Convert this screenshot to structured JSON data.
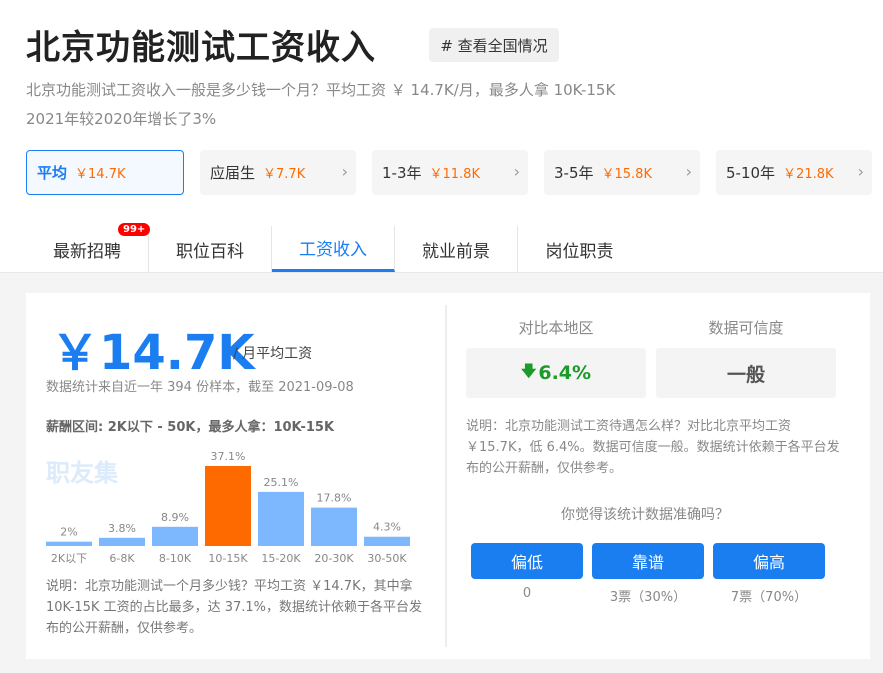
{
  "header": {
    "title": "北京功能测试工资收入",
    "national_button": "# 查看全国情况",
    "subtitle_line1": "北京功能测试工资收入一般是多少钱一个月？平均工资 ￥ 14.7K/月，最多人拿 10K-15K",
    "subtitle_line2": "2021年较2020年增长了3%"
  },
  "exp_tabs": [
    {
      "label": "平均",
      "value": "￥14.7K",
      "active": true
    },
    {
      "label": "应届生",
      "value": "￥7.7K",
      "active": false
    },
    {
      "label": "1-3年",
      "value": "￥11.8K",
      "active": false
    },
    {
      "label": "3-5年",
      "value": "￥15.8K",
      "active": false
    },
    {
      "label": "5-10年",
      "value": "￥21.8K",
      "active": false
    }
  ],
  "nav": {
    "items": [
      "最新招聘",
      "职位百科",
      "工资收入",
      "就业前景",
      "岗位职责"
    ],
    "badge": "99+",
    "active_index": 2
  },
  "salary": {
    "amount": "￥14.7K",
    "unit": "/ 月平均工资",
    "stat": "数据统计来自近一年 394 份样本，截至 2021-09-08",
    "range": "薪酬区间: 2K以下 - 50K，最多人拿：10K-15K",
    "watermark": "职友集",
    "explain": "说明：北京功能测试一个月多少钱？平均工资 ￥14.7K，其中拿 10K-15K 工资的占比最多，达 37.1%，数据统计依赖于各平台发布的公开薪酬，仅供参考。"
  },
  "chart_data": {
    "type": "bar",
    "categories": [
      "2K以下",
      "6-8K",
      "8-10K",
      "10-15K",
      "15-20K",
      "20-30K",
      "30-50K"
    ],
    "values": [
      2,
      3.8,
      8.9,
      37.1,
      25.1,
      17.8,
      4.3
    ],
    "value_labels": [
      "2%",
      "3.8%",
      "8.9%",
      "37.1%",
      "25.1%",
      "17.8%",
      "4.3%"
    ],
    "highlight_index": 3,
    "colors": {
      "normal": "#7db8ff",
      "highlight": "#ff6a00"
    },
    "unit": "%"
  },
  "compare": {
    "local_label": "对比本地区",
    "local_value": "6.4%",
    "local_direction": "down",
    "credibility_label": "数据可信度",
    "credibility_value": "一般",
    "explain": "说明：北京功能测试工资待遇怎么样？对比北京平均工资 ￥15.7K，低 6.4%。数据可信度一般。数据统计依赖于各平台发布的公开薪酬，仅供参考。",
    "question": "你觉得该统计数据准确吗？",
    "votes": [
      {
        "label": "偏低",
        "count": "0"
      },
      {
        "label": "靠谱",
        "count": "3票（30%）"
      },
      {
        "label": "偏高",
        "count": "7票（70%）"
      }
    ]
  },
  "colors": {
    "accent": "#1a7df0",
    "orange": "#ff6a00",
    "green": "#1c9a2a"
  }
}
